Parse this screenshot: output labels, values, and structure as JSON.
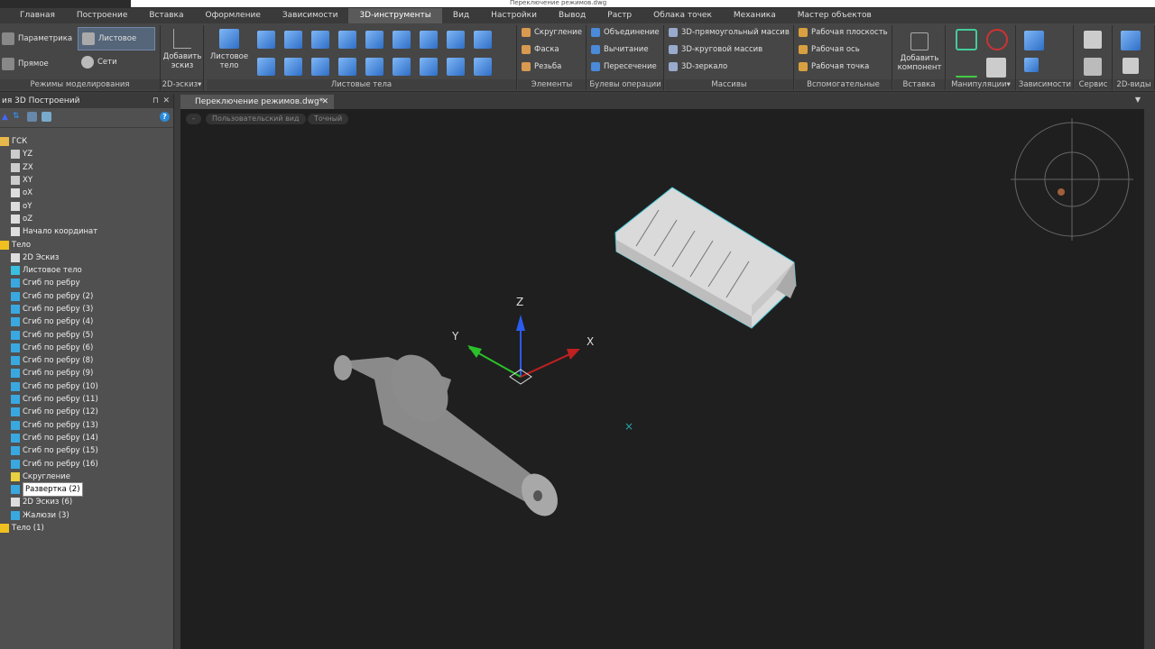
{
  "titlebar": {
    "title": "Переключение режимов.dwg"
  },
  "menu_tabs": [
    "Главная",
    "Построение",
    "Вставка",
    "Оформление",
    "Зависимости",
    "3D-инструменты",
    "Вид",
    "Настройки",
    "Вывод",
    "Растр",
    "Облака точек",
    "Механика",
    "Мастер объектов"
  ],
  "active_tab": "3D-инструменты",
  "ribbon": {
    "modes": {
      "label": "Режимы моделирования",
      "items": [
        "Параметрика",
        "Листовое",
        "Прямое",
        "Сети"
      ]
    },
    "sketch": {
      "label": "2D-эскиз▾",
      "button": "Добавить эскиз"
    },
    "sheet": {
      "label": "Листовые тела",
      "button": "Листовое тело"
    },
    "elements": {
      "label": "Элементы",
      "items": [
        "Скругление",
        "Фаска",
        "Резьба"
      ]
    },
    "boolean": {
      "label": "Булевы операции",
      "items": [
        "Объединение",
        "Вычитание",
        "Пересечение"
      ]
    },
    "arrays": {
      "label": "Массивы",
      "items": [
        "3D-прямоугольный массив",
        "3D-круговой массив",
        "3D-зеркало"
      ]
    },
    "aux": {
      "label": "Вспомогательные",
      "items": [
        "Рабочая плоскость",
        "Рабочая ось",
        "Рабочая точка"
      ]
    },
    "insert": {
      "label": "Вставка",
      "button": "Добавить компонент"
    },
    "manip": {
      "label": "Манипуляции▾"
    },
    "deps": {
      "label": "Зависимости"
    },
    "service": {
      "label": "Сервис"
    },
    "views": {
      "label": "2D-виды"
    }
  },
  "panel": {
    "title": "ия 3D Построений",
    "help": "?"
  },
  "tree": [
    {
      "label": "ГСК",
      "level": 0,
      "icon": "folder"
    },
    {
      "label": "YZ",
      "level": 1,
      "icon": "plane"
    },
    {
      "label": "ZX",
      "level": 1,
      "icon": "plane"
    },
    {
      "label": "XY",
      "level": 1,
      "icon": "plane"
    },
    {
      "label": "oX",
      "level": 1,
      "icon": "axis"
    },
    {
      "label": "oY",
      "level": 1,
      "icon": "axis"
    },
    {
      "label": "oZ",
      "level": 1,
      "icon": "axis"
    },
    {
      "label": "Начало координат",
      "level": 1,
      "icon": "point"
    },
    {
      "label": "Тело",
      "level": 0,
      "icon": "body"
    },
    {
      "label": "2D Эскиз",
      "level": 1,
      "icon": "sketch"
    },
    {
      "label": "Листовое тело",
      "level": 1,
      "icon": "sheet"
    },
    {
      "label": "Сгиб по ребру",
      "level": 1,
      "icon": "bend"
    },
    {
      "label": "Сгиб по ребру (2)",
      "level": 1,
      "icon": "bend"
    },
    {
      "label": "Сгиб по ребру (3)",
      "level": 1,
      "icon": "bend"
    },
    {
      "label": "Сгиб по ребру (4)",
      "level": 1,
      "icon": "bend"
    },
    {
      "label": "Сгиб по ребру (5)",
      "level": 1,
      "icon": "bend"
    },
    {
      "label": "Сгиб по ребру (6)",
      "level": 1,
      "icon": "bend"
    },
    {
      "label": "Сгиб по ребру (8)",
      "level": 1,
      "icon": "bend"
    },
    {
      "label": "Сгиб по ребру (9)",
      "level": 1,
      "icon": "bend"
    },
    {
      "label": "Сгиб по ребру (10)",
      "level": 1,
      "icon": "bend"
    },
    {
      "label": "Сгиб по ребру (11)",
      "level": 1,
      "icon": "bend"
    },
    {
      "label": "Сгиб по ребру (12)",
      "level": 1,
      "icon": "bend"
    },
    {
      "label": "Сгиб по ребру (13)",
      "level": 1,
      "icon": "bend"
    },
    {
      "label": "Сгиб по ребру (14)",
      "level": 1,
      "icon": "bend"
    },
    {
      "label": "Сгиб по ребру (15)",
      "level": 1,
      "icon": "bend"
    },
    {
      "label": "Сгиб по ребру (16)",
      "level": 1,
      "icon": "bend"
    },
    {
      "label": "Скругление",
      "level": 1,
      "icon": "fillet"
    },
    {
      "label": "Развертка (2)",
      "level": 1,
      "icon": "unfold",
      "selected": true
    },
    {
      "label": "2D Эскиз (6)",
      "level": 1,
      "icon": "sketch"
    },
    {
      "label": "Жалюзи (3)",
      "level": 1,
      "icon": "louver"
    },
    {
      "label": "Тело (1)",
      "level": 0,
      "icon": "body"
    }
  ],
  "viewport": {
    "doc_tab": "Переключение режимов.dwg*",
    "view_minus": "-",
    "view_name": "Пользовательский вид",
    "visual_style": "Точный",
    "axes": {
      "x": "X",
      "y": "Y",
      "z": "Z"
    }
  },
  "colors": {
    "accent": "#5a5a5a",
    "viewport_bg": "#1f1f1f",
    "selection_edge": "#47c8d8"
  }
}
